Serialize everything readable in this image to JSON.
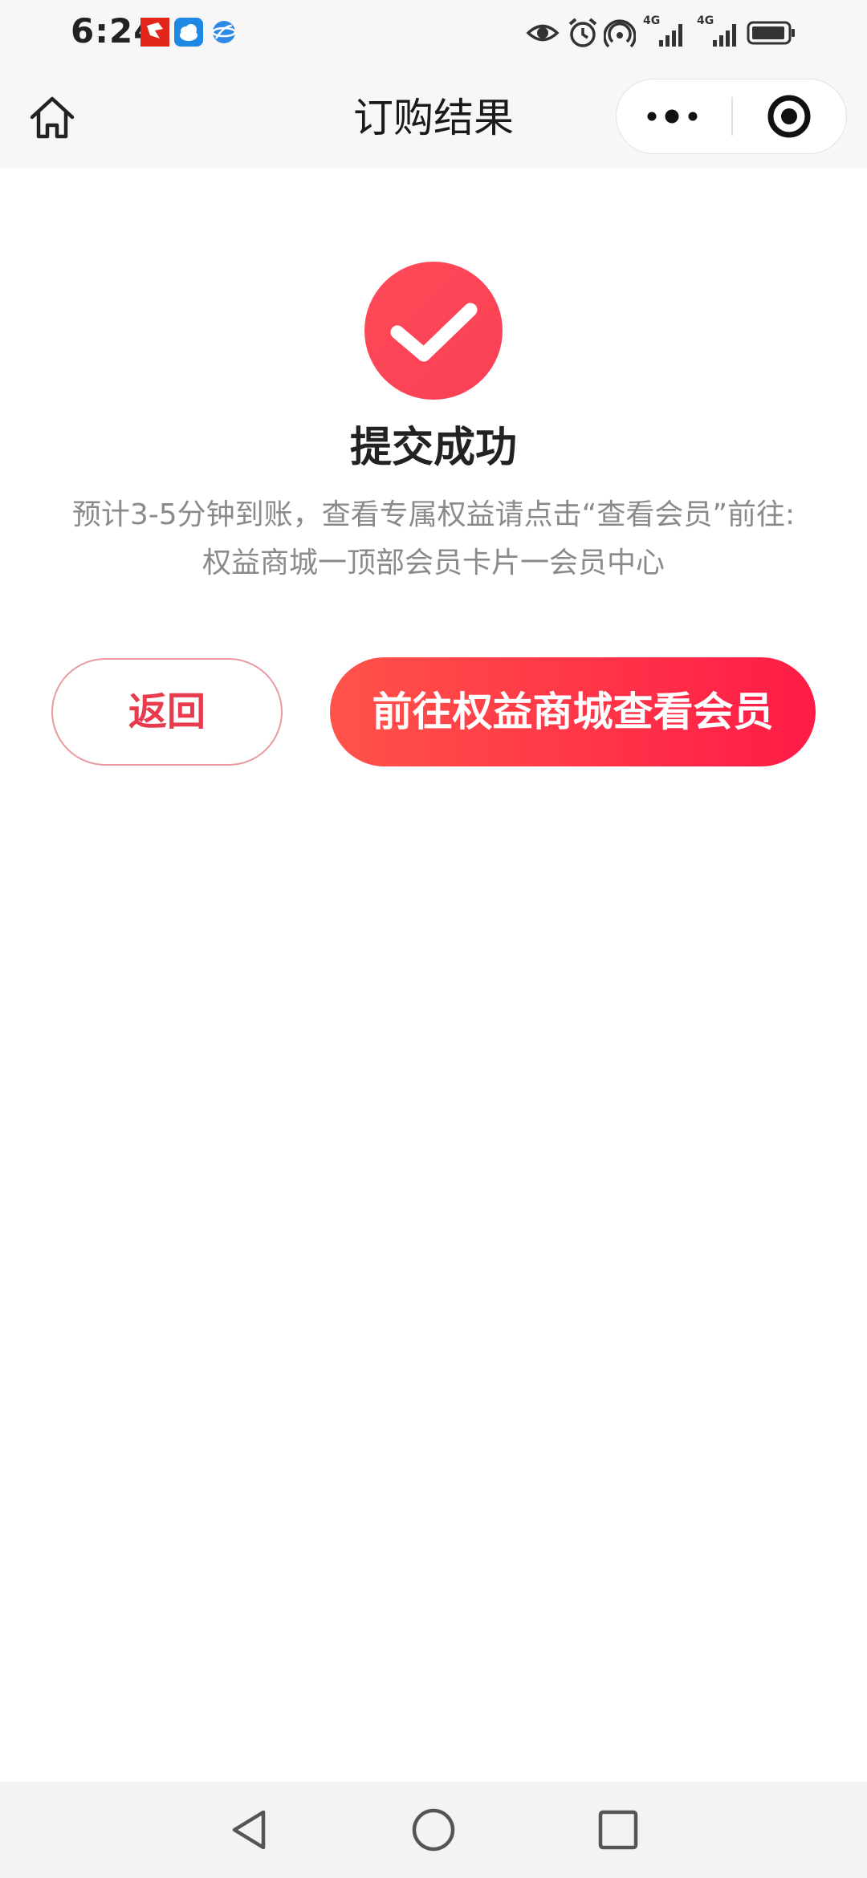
{
  "status_bar": {
    "time": "6:24",
    "notification_icons": [
      "app-notification-icon",
      "weather-icon",
      "browser-icon"
    ],
    "right_icons": [
      "eye-icon",
      "alarm-icon",
      "hotspot-icon",
      "signal-4g-icon",
      "signal-4g-icon",
      "battery-icon"
    ],
    "network_1": "4G",
    "network_2": "4G"
  },
  "nav": {
    "title": "订购结果"
  },
  "result": {
    "title": "提交成功",
    "desc_line1": "预计3-5分钟到账，查看专属权益请点击“查看会员”前往:",
    "desc_line2": "权益商城一顶部会员卡片一会员中心"
  },
  "buttons": {
    "back_label": "返回",
    "primary_label": "前往权益商城查看会员"
  },
  "colors": {
    "accent": "#ff2d4c",
    "success_circle": "#ff4756",
    "back_text": "#e83b4d"
  }
}
